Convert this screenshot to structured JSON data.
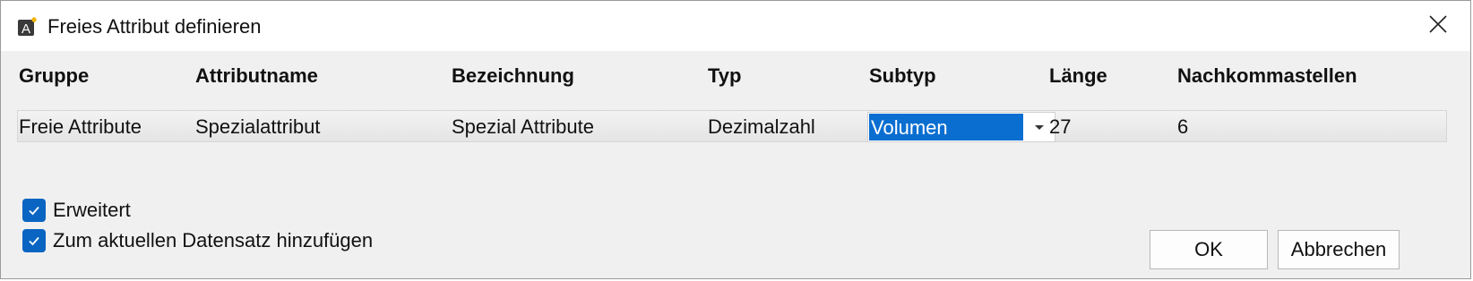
{
  "window": {
    "title": "Freies Attribut definieren",
    "icon": "app-attribute-icon",
    "close_icon": "close-icon"
  },
  "table": {
    "columns": [
      "Gruppe",
      "Attributname",
      "Bezeichnung",
      "Typ",
      "Subtyp",
      "Länge",
      "Nachkommastellen"
    ],
    "row": {
      "gruppe": "Freie Attribute",
      "attributname": "Spezialattribut",
      "bezeichnung": "Spezial Attribute",
      "typ": "Dezimalzahl",
      "subtyp": "Volumen",
      "laenge": "27",
      "nachkommastellen": "6"
    }
  },
  "options": {
    "erweitert": {
      "label": "Erweitert",
      "checked": true
    },
    "hinzufuegen": {
      "label": "Zum aktuellen Datensatz hinzufügen",
      "checked": true
    }
  },
  "buttons": {
    "ok": "OK",
    "cancel": "Abbrechen"
  },
  "colors": {
    "accent": "#0a6ed1",
    "checkbox": "#0a64c2",
    "background": "#f0f0f0"
  }
}
